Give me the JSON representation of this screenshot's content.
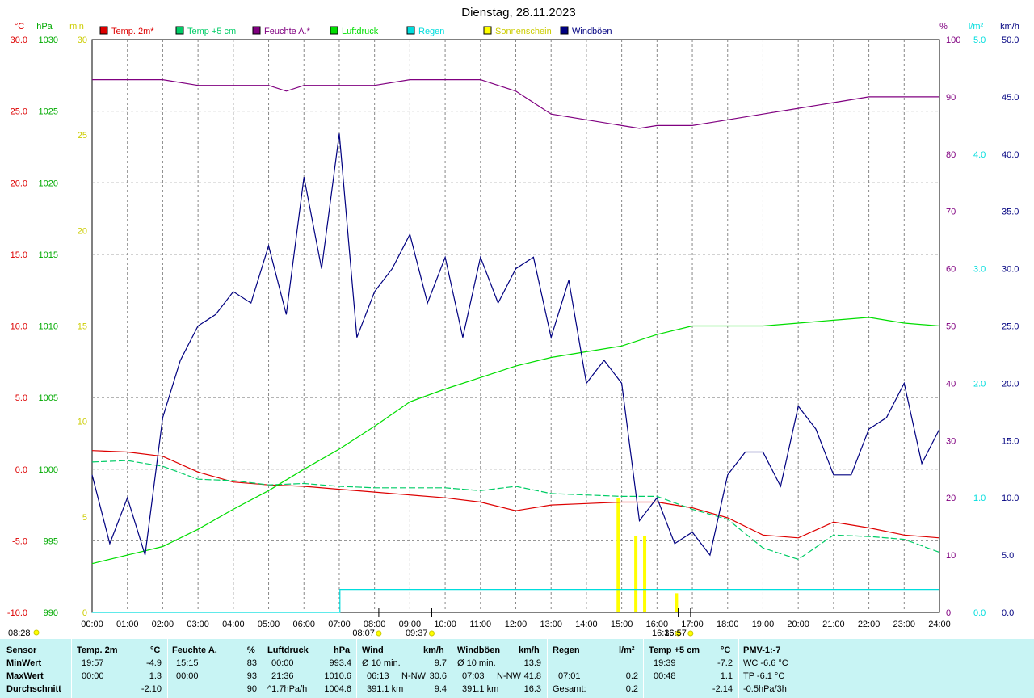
{
  "chart_data": {
    "type": "line",
    "title": "Dienstag, 28.11.2023",
    "x_ticks": [
      "00:00",
      "01:00",
      "02:00",
      "03:00",
      "04:00",
      "05:00",
      "06:00",
      "07:00",
      "08:00",
      "09:00",
      "10:00",
      "11:00",
      "12:00",
      "13:00",
      "14:00",
      "15:00",
      "16:00",
      "17:00",
      "18:00",
      "19:00",
      "20:00",
      "21:00",
      "22:00",
      "23:00",
      "24:00"
    ],
    "axes": {
      "temp": {
        "unit": "°C",
        "ticks": [
          "30.0",
          "25.0",
          "20.0",
          "15.0",
          "10.0",
          "5.0",
          "0.0",
          "-5.0",
          "-10.0"
        ],
        "range": [
          -10,
          30
        ],
        "color": "#dd0000"
      },
      "press": {
        "unit": "hPa",
        "ticks": [
          "1030",
          "1025",
          "1020",
          "1015",
          "1010",
          "1005",
          "1000",
          "995",
          "990"
        ],
        "range": [
          990,
          1030
        ],
        "color": "#00aa00"
      },
      "sun": {
        "unit": "min",
        "ticks": [
          "30",
          "25",
          "20",
          "15",
          "10",
          "5",
          "0"
        ],
        "range": [
          0,
          30
        ],
        "color": "#cccc00"
      },
      "hum": {
        "unit": "%",
        "ticks": [
          "100",
          "90",
          "80",
          "70",
          "60",
          "50",
          "40",
          "30",
          "20",
          "10",
          "0"
        ],
        "range": [
          0,
          100
        ],
        "color": "#800080"
      },
      "rain": {
        "unit": "l/m²",
        "ticks": [
          "5.0",
          "4.0",
          "3.0",
          "2.0",
          "1.0",
          "0.0"
        ],
        "range": [
          0,
          5
        ],
        "color": "#00dddd"
      },
      "wind": {
        "unit": "km/h",
        "ticks": [
          "50.0",
          "45.0",
          "40.0",
          "35.0",
          "30.0",
          "25.0",
          "20.0",
          "15.0",
          "10.0",
          "5.0",
          "0.0"
        ],
        "range": [
          0,
          50
        ],
        "color": "#000080"
      }
    },
    "legend": [
      {
        "name": "Temp. 2m*",
        "color": "#dd0000"
      },
      {
        "name": "Temp +5 cm",
        "color": "#00cc66"
      },
      {
        "name": "Feuchte A.*",
        "color": "#800080"
      },
      {
        "name": "Luftdruck",
        "color": "#00dd00"
      },
      {
        "name": "Regen",
        "color": "#00dddd"
      },
      {
        "name": "Sonnenschein",
        "color": "#ffff00"
      },
      {
        "name": "Windböen",
        "color": "#000080"
      }
    ],
    "series": [
      {
        "name": "Temp. 2m*",
        "axis": "temp",
        "x": [
          0,
          1,
          2,
          3,
          4,
          5,
          6,
          7,
          8,
          9,
          10,
          11,
          12,
          13,
          14,
          15,
          16,
          17,
          18,
          19,
          20,
          21,
          22,
          23,
          24
        ],
        "y": [
          1.3,
          1.2,
          0.9,
          -0.2,
          -0.9,
          -1.1,
          -1.2,
          -1.4,
          -1.6,
          -1.8,
          -2.0,
          -2.3,
          -2.9,
          -2.5,
          -2.4,
          -2.3,
          -2.3,
          -2.7,
          -3.4,
          -4.6,
          -4.8,
          -3.7,
          -4.1,
          -4.6,
          -4.8
        ]
      },
      {
        "name": "Temp +5 cm",
        "axis": "temp",
        "x": [
          0,
          1,
          2,
          3,
          4,
          5,
          6,
          7,
          8,
          9,
          10,
          11,
          12,
          13,
          14,
          15,
          16,
          17,
          18,
          19,
          20,
          21,
          22,
          23,
          24
        ],
        "y": [
          0.5,
          0.6,
          0.2,
          -0.7,
          -0.8,
          -1.1,
          -1.0,
          -1.2,
          -1.3,
          -1.3,
          -1.3,
          -1.5,
          -1.2,
          -1.7,
          -1.8,
          -1.9,
          -1.9,
          -2.8,
          -3.5,
          -5.5,
          -6.3,
          -4.6,
          -4.7,
          -4.9,
          -5.8
        ]
      },
      {
        "name": "Feuchte A.*",
        "axis": "hum",
        "x": [
          0,
          1,
          2,
          3,
          4,
          5,
          5.5,
          6,
          7,
          8,
          9,
          10,
          11,
          12,
          13,
          14,
          15,
          15.5,
          16,
          17,
          18,
          19,
          20,
          21,
          22,
          23,
          24
        ],
        "y": [
          93,
          93,
          93,
          92,
          92,
          92,
          91,
          92,
          92,
          92,
          93,
          93,
          93,
          91,
          87,
          86,
          85,
          84.5,
          85,
          85,
          86,
          87,
          88,
          89,
          90,
          90,
          90
        ]
      },
      {
        "name": "Luftdruck",
        "axis": "press",
        "x": [
          0,
          1,
          2,
          3,
          4,
          5,
          6,
          7,
          8,
          9,
          10,
          11,
          12,
          13,
          14,
          15,
          16,
          17,
          18,
          19,
          20,
          21,
          22,
          23,
          24
        ],
        "y": [
          993.4,
          994.0,
          994.6,
          995.8,
          997.2,
          998.5,
          1000.0,
          1001.4,
          1003.0,
          1004.7,
          1005.6,
          1006.4,
          1007.2,
          1007.8,
          1008.2,
          1008.6,
          1009.4,
          1010.0,
          1010.0,
          1010.0,
          1010.2,
          1010.4,
          1010.6,
          1010.2,
          1010.0
        ]
      },
      {
        "name": "Regen",
        "axis": "rain",
        "x": [
          0,
          7.02,
          7.02,
          24
        ],
        "y": [
          0,
          0,
          0.2,
          0.2
        ]
      },
      {
        "name": "Windböen",
        "axis": "wind",
        "x": [
          0,
          0.5,
          1,
          1.5,
          2,
          2.5,
          3,
          3.5,
          4,
          4.5,
          5,
          5.5,
          6,
          6.5,
          7,
          7.5,
          8,
          8.5,
          9,
          9.5,
          10,
          10.5,
          11,
          11.5,
          12,
          12.5,
          13,
          13.5,
          14,
          14.5,
          15,
          15.5,
          16,
          16.5,
          17,
          17.5,
          18,
          18.5,
          19,
          19.5,
          20,
          20.5,
          21,
          21.5,
          22,
          22.5,
          23,
          23.5,
          24
        ],
        "y": [
          12,
          6,
          10,
          5,
          17,
          22,
          25,
          26,
          28,
          27,
          32,
          26,
          38,
          30,
          41.8,
          24,
          28,
          30,
          33,
          27,
          31,
          24,
          31,
          27,
          30,
          31,
          24,
          29,
          20,
          22,
          20,
          8,
          10,
          6,
          7,
          5,
          12,
          14,
          14,
          11,
          18,
          16,
          12,
          12,
          16,
          17,
          20,
          13,
          16
        ]
      }
    ],
    "sunshine_bars": [
      {
        "x": 14.9,
        "min": 6
      },
      {
        "x": 15.4,
        "min": 4
      },
      {
        "x": 15.65,
        "min": 4
      },
      {
        "x": 16.55,
        "min": 1
      }
    ],
    "markers": [
      {
        "label": "08:28",
        "x_label_pos": "left"
      },
      {
        "label": "08:07",
        "x": 8.12
      },
      {
        "label": "09:37",
        "x": 9.62
      },
      {
        "label": "16:36",
        "x": 16.6
      },
      {
        "label": "16:57",
        "x": 16.95
      }
    ]
  },
  "table": {
    "headers": [
      {
        "label": "Sensor",
        "unit": ""
      },
      {
        "label": "Temp. 2m",
        "unit": "°C"
      },
      {
        "label": "Feuchte A.",
        "unit": "%"
      },
      {
        "label": "Luftdruck",
        "unit": "hPa"
      },
      {
        "label": "Wind",
        "unit": "km/h"
      },
      {
        "label": "Windböen",
        "unit": "km/h"
      },
      {
        "label": "Regen",
        "unit": "l/m²"
      },
      {
        "label": "Temp +5 cm",
        "unit": "°C"
      },
      {
        "label": "PMV-1:-7",
        "unit": ""
      }
    ],
    "rows": [
      {
        "label": "MinWert",
        "temp_time": "19:57",
        "temp_val": "-4.9",
        "hum_time": "15:15",
        "hum_val": "83",
        "press_time": "00:00",
        "press_val": "993.4",
        "wind_a": "Ø 10 min.",
        "wind_val": "9.7",
        "gust_a": "Ø 10 min.",
        "gust_val": "13.9",
        "rain_a": "",
        "rain_val": "",
        "t5_time": "19:39",
        "t5_val": "-7.2",
        "pmv": "WC -6.6 °C"
      },
      {
        "label": "MaxWert",
        "temp_time": "00:00",
        "temp_val": "1.3",
        "hum_time": "00:00",
        "hum_val": "93",
        "press_time": "21:36",
        "press_val": "1010.6",
        "wind_a": "06:13",
        "wind_dir": "N-NW",
        "wind_val": "30.6",
        "gust_a": "07:03",
        "gust_dir": "N-NW",
        "gust_val": "41.8",
        "rain_a": "07:01",
        "rain_val": "0.2",
        "t5_time": "00:48",
        "t5_val": "1.1",
        "pmv": "TP -6.1 °C"
      },
      {
        "label": "Durchschnitt",
        "temp_time": "",
        "temp_val": "-2.10",
        "hum_time": "",
        "hum_val": "90",
        "press_time": "^1.7hPa/h",
        "press_val": "1004.6",
        "wind_a": "391.1 km",
        "wind_val": "9.4",
        "gust_a": "391.1 km",
        "gust_val": "16.3",
        "rain_a": "Gesamt:",
        "rain_val": "0.2",
        "t5_time": "",
        "t5_val": "-2.14",
        "pmv": "-0.5hPa/3h"
      }
    ]
  }
}
